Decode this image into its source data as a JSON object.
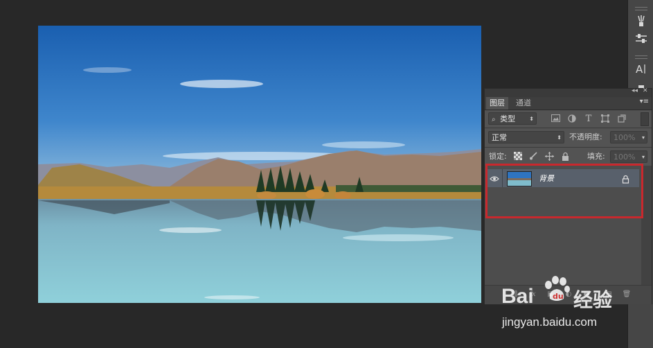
{
  "layers_panel": {
    "tabs": [
      "图层",
      "通道"
    ],
    "filter_kind": "类型",
    "blend_mode": "正常",
    "opacity_label": "不透明度:",
    "opacity_value": "100%",
    "lock_label": "锁定:",
    "fill_label": "填充:",
    "fill_value": "100%",
    "layers": [
      {
        "name": "背景",
        "visible": true,
        "locked": true
      }
    ]
  },
  "icons": {
    "search": "search-icon",
    "lock": "lock-icon",
    "eye": "eye-icon"
  },
  "colors": {
    "panel_bg": "#535353",
    "selected_layer": "#58606b",
    "highlight": "#c9282d",
    "workspace": "#282828"
  },
  "watermark": {
    "brand_left": "Bai",
    "brand_right": "经验",
    "url": "jingyan.baidu.com"
  }
}
